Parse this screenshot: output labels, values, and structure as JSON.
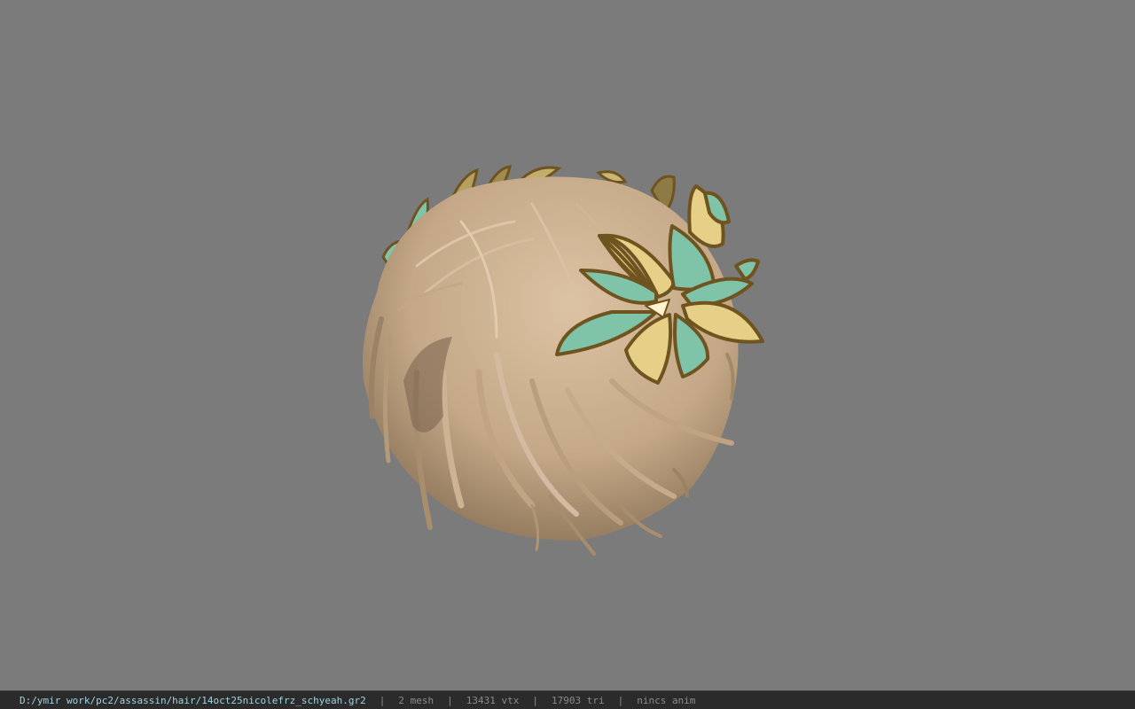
{
  "viewport": {
    "background_color": "#7b7b7b",
    "model": {
      "hair_color": "#c4a887",
      "leaf_gold": "#e6cf86",
      "leaf_teal": "#7fc3a8",
      "leaf_outline": "#6f5420"
    }
  },
  "status_bar": {
    "file_path": "D:/ymir work/pc2/assassin/hair/14oct25nicolefrz_schyeah.gr2",
    "separator": "|",
    "mesh_count": "2 mesh",
    "vertex_count": "13431 vtx",
    "triangle_count": "17903 tri",
    "anim_status": "nincs anim"
  }
}
